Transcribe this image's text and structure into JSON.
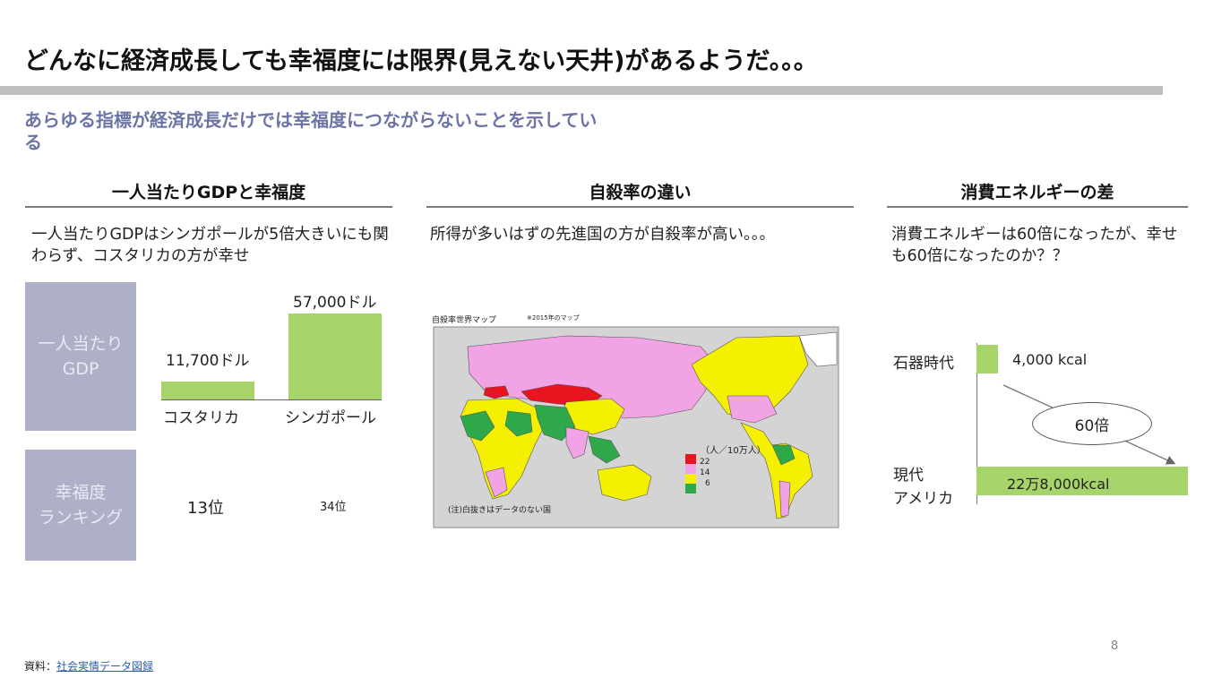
{
  "title": "どんなに経済成長しても幸福度には限界(見えない天井)があるようだ。。。",
  "subtitle": "あらゆる指標が経済成長だけでは幸福度につながらないことを示している",
  "columns": {
    "gdp": {
      "heading": "一人当たりGDPと幸福度",
      "text": "一人当たりGDPはシンガポールが5倍大きいにも関わらず、コスタリカの方が幸せ",
      "row_label_gdp": "一人当たり GDP",
      "row_label_gdp_line1": "一人当たり",
      "row_label_gdp_line2": "GDP",
      "row_label_rank_line1": "幸福度",
      "row_label_rank_line2": "ランキング",
      "countries": [
        {
          "name": "コスタリカ",
          "gdp_label": "11,700ドル",
          "gdp_value": 11700,
          "rank": "13位"
        },
        {
          "name": "シンガポール",
          "gdp_label": "57,000ドル",
          "gdp_value": 57000,
          "rank": "34位"
        }
      ]
    },
    "suicide": {
      "heading": "自殺率の違い",
      "text": "所得が多いはずの先進国の方が自殺率が高い。。。",
      "map": {
        "title": "自殺率世界マップ",
        "note_year": "※2015年のマップ",
        "unit": "（人／10万人）",
        "legend": [
          {
            "label": "22",
            "color": "#e8141e"
          },
          {
            "label": "14",
            "color": "#f2a3e6"
          },
          {
            "label": "6",
            "color": "#f5f000"
          },
          {
            "label": "",
            "color": "#2fa84a"
          }
        ],
        "footnote": "(注)白抜きはデータのない国"
      }
    },
    "energy": {
      "heading": "消費エネルギーの差",
      "text": "消費エネルギーは60倍になったが、幸せも60倍になったのか？？",
      "stone_age_label": "石器時代",
      "stone_age_value": "4,000 kcal",
      "stone_age_kcal": 4000,
      "modern_label_line1": "現代",
      "modern_label_line2": "アメリカ",
      "modern_value": "22万8,000kcal",
      "modern_kcal": 228000,
      "ratio_label": "60倍"
    }
  },
  "page_number": "8",
  "source_prefix": "資料：",
  "source_link": "社会実情データ図録"
}
